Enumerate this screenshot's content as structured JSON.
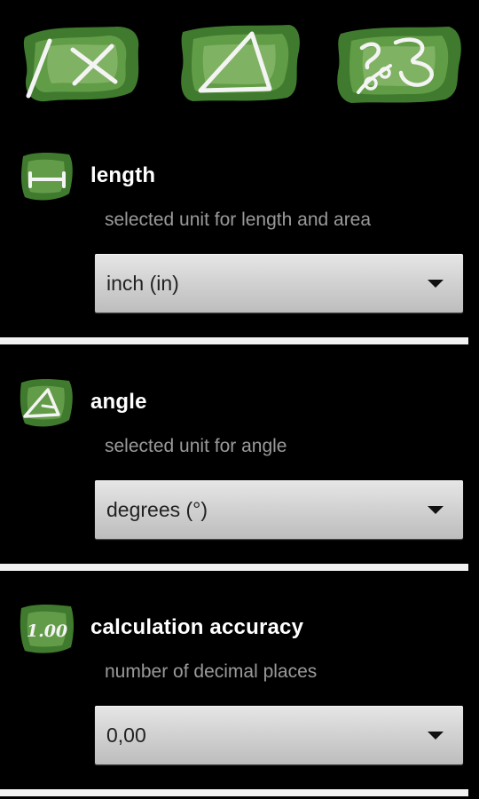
{
  "tabs": [
    {
      "name": "calculator",
      "icon": "divide-multiply-icon",
      "selected": false
    },
    {
      "name": "triangle",
      "icon": "triangle-icon",
      "selected": false
    },
    {
      "name": "settings",
      "icon": "scale-ratio-icon",
      "selected": false
    }
  ],
  "sections": {
    "length": {
      "icon": "length-ruler-icon",
      "title": "length",
      "description": "selected unit for length and area",
      "value": "inch (in)"
    },
    "angle": {
      "icon": "angle-triangle-icon",
      "title": "angle",
      "description": "selected unit for angle",
      "value": "degrees (°)"
    },
    "accuracy": {
      "icon": "decimal-accuracy-icon",
      "icon_text": "1.00",
      "title": "calculation accuracy",
      "description": "number of decimal places",
      "value": "0,00"
    }
  },
  "colors": {
    "background": "#000000",
    "leaf_green": "#3f7a2e",
    "leaf_light": "#8fbf6a",
    "chalk": "#f2f2f2",
    "description_gray": "#9a9a9a",
    "select_bg": "#d2d2d2"
  }
}
